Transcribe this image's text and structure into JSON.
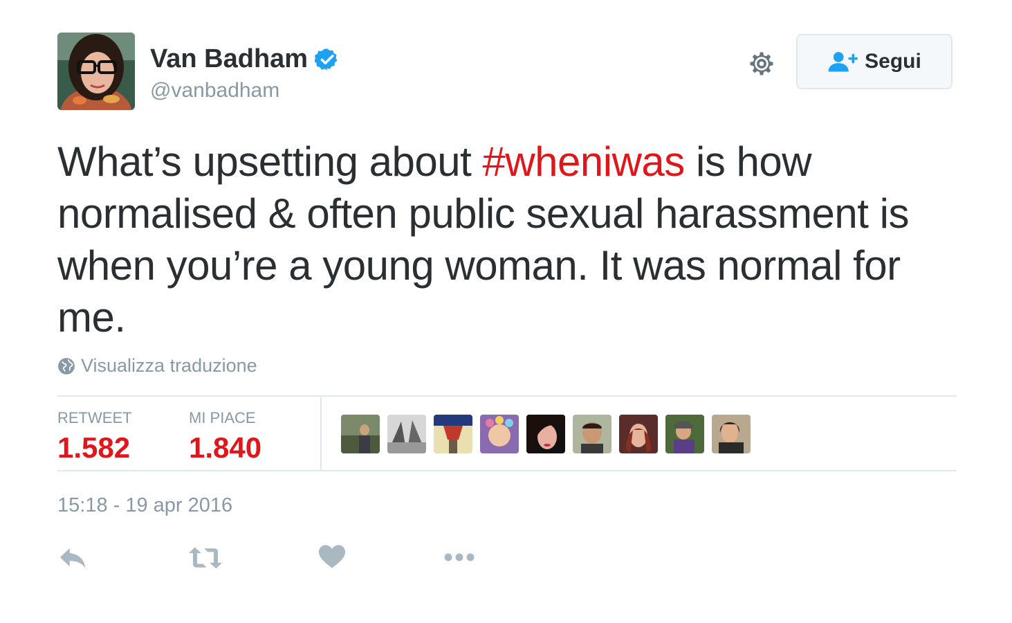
{
  "user": {
    "display_name": "Van Badham",
    "username": "@vanbadham",
    "verified": true,
    "avatar_icon": "profile-photo"
  },
  "header": {
    "settings_icon": "gear-icon",
    "follow_icon": "add-user-icon",
    "follow_label": "Segui"
  },
  "tweet": {
    "text_before": "What’s upsetting about ",
    "hashtag": "#wheniwas",
    "text_after": " is how normalised & often public sexual harassment is when you’re a young woman. It was normal for me."
  },
  "translation": {
    "icon": "globe-icon",
    "label": "Visualizza traduzione"
  },
  "stats": {
    "retweets_label": "RETWEET",
    "retweets_value": "1.582",
    "likes_label": "MI PIACE",
    "likes_value": "1.840"
  },
  "likers": [
    {
      "icon": "liker-avatar-1"
    },
    {
      "icon": "liker-avatar-2"
    },
    {
      "icon": "liker-avatar-3"
    },
    {
      "icon": "liker-avatar-4"
    },
    {
      "icon": "liker-avatar-5"
    },
    {
      "icon": "liker-avatar-6"
    },
    {
      "icon": "liker-avatar-7"
    },
    {
      "icon": "liker-avatar-8"
    },
    {
      "icon": "liker-avatar-9"
    }
  ],
  "timestamp": "15:18 - 19 apr 2016",
  "actions": {
    "reply_icon": "reply-icon",
    "retweet_icon": "retweet-icon",
    "like_icon": "heart-icon",
    "more_icon": "more-dots-icon"
  },
  "colors": {
    "accent": "#e0161b",
    "text": "#292f33",
    "muted": "#8899a6",
    "border": "#e1e8ed",
    "verified": "#1da1f2"
  }
}
